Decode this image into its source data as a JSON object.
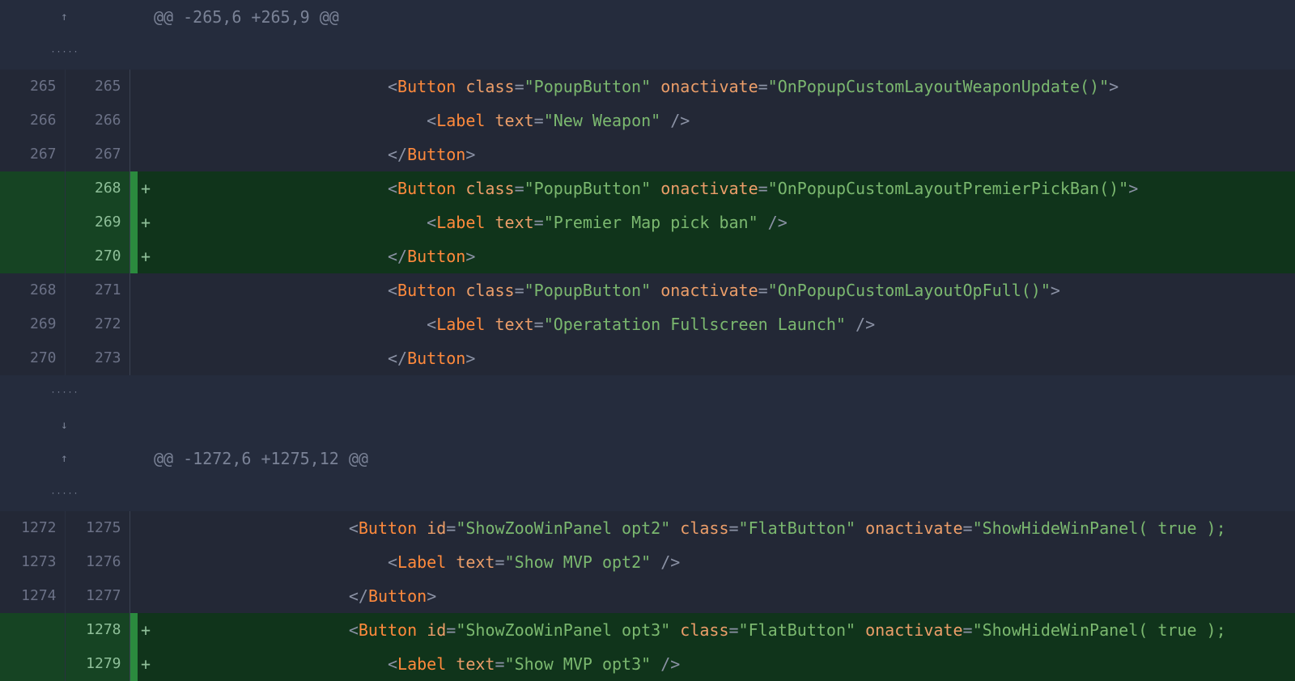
{
  "hunks": [
    {
      "header": "@@ -265,6 +265,9 @@"
    },
    {
      "header": "@@ -1272,6 +1275,12 @@"
    }
  ],
  "lines": [
    {
      "old": "265",
      "new": "265",
      "type": "ctx",
      "indent": 24,
      "tokens": [
        "&lt;",
        "Button",
        " ",
        "class",
        "=",
        "\"PopupButton\"",
        " ",
        "onactivate",
        "=",
        "\"OnPopupCustomLayoutWeaponUpdate()\"",
        "&gt;"
      ],
      "cls": [
        "pun",
        "tag",
        "",
        "attr",
        "eq",
        "str",
        "",
        "attr",
        "eq",
        "str",
        "pun"
      ]
    },
    {
      "old": "266",
      "new": "266",
      "type": "ctx",
      "indent": 28,
      "tokens": [
        "&lt;",
        "Label",
        " ",
        "text",
        "=",
        "\"New Weapon\"",
        " ",
        "/&gt;"
      ],
      "cls": [
        "pun",
        "tag",
        "",
        "attr",
        "eq",
        "str",
        "",
        "pun"
      ]
    },
    {
      "old": "267",
      "new": "267",
      "type": "ctx",
      "indent": 24,
      "tokens": [
        "&lt;/",
        "Button",
        "&gt;"
      ],
      "cls": [
        "pun",
        "tag",
        "pun"
      ]
    },
    {
      "old": "",
      "new": "268",
      "type": "add",
      "indent": 24,
      "tokens": [
        "&lt;",
        "Button",
        " ",
        "class",
        "=",
        "\"PopupButton\"",
        " ",
        "onactivate",
        "=",
        "\"OnPopupCustomLayoutPremierPickBan()\"",
        "&gt;"
      ],
      "cls": [
        "pun",
        "tag",
        "",
        "attr",
        "eq",
        "str",
        "",
        "attr",
        "eq",
        "str",
        "pun"
      ]
    },
    {
      "old": "",
      "new": "269",
      "type": "add",
      "indent": 28,
      "tokens": [
        "&lt;",
        "Label",
        " ",
        "text",
        "=",
        "\"Premier Map pick ban\"",
        " ",
        "/&gt;"
      ],
      "cls": [
        "pun",
        "tag",
        "",
        "attr",
        "eq",
        "str",
        "",
        "pun"
      ]
    },
    {
      "old": "",
      "new": "270",
      "type": "add",
      "indent": 24,
      "tokens": [
        "&lt;/",
        "Button",
        "&gt;"
      ],
      "cls": [
        "pun",
        "tag",
        "pun"
      ]
    },
    {
      "old": "268",
      "new": "271",
      "type": "ctx",
      "indent": 24,
      "tokens": [
        "&lt;",
        "Button",
        " ",
        "class",
        "=",
        "\"PopupButton\"",
        " ",
        "onactivate",
        "=",
        "\"OnPopupCustomLayoutOpFull()\"",
        "&gt;"
      ],
      "cls": [
        "pun",
        "tag",
        "",
        "attr",
        "eq",
        "str",
        "",
        "attr",
        "eq",
        "str",
        "pun"
      ]
    },
    {
      "old": "269",
      "new": "272",
      "type": "ctx",
      "indent": 28,
      "tokens": [
        "&lt;",
        "Label",
        " ",
        "text",
        "=",
        "\"Operatation Fullscreen Launch\"",
        " ",
        "/&gt;"
      ],
      "cls": [
        "pun",
        "tag",
        "",
        "attr",
        "eq",
        "str",
        "",
        "pun"
      ]
    },
    {
      "old": "270",
      "new": "273",
      "type": "ctx",
      "indent": 24,
      "tokens": [
        "&lt;/",
        "Button",
        "&gt;"
      ],
      "cls": [
        "pun",
        "tag",
        "pun"
      ]
    },
    {
      "old": "1272",
      "new": "1275",
      "type": "ctx",
      "indent": 20,
      "tokens": [
        "&lt;",
        "Button",
        " ",
        "id",
        "=",
        "\"ShowZooWinPanel opt2\"",
        " ",
        "class",
        "=",
        "\"FlatButton\"",
        " ",
        "onactivate",
        "=",
        "\"ShowHideWinPanel( true );"
      ],
      "cls": [
        "pun",
        "tag",
        "",
        "attr",
        "eq",
        "str",
        "",
        "attr",
        "eq",
        "str",
        "",
        "attr",
        "eq",
        "str"
      ]
    },
    {
      "old": "1273",
      "new": "1276",
      "type": "ctx",
      "indent": 24,
      "tokens": [
        "&lt;",
        "Label",
        " ",
        "text",
        "=",
        "\"Show MVP opt2\"",
        " ",
        "/&gt;"
      ],
      "cls": [
        "pun",
        "tag",
        "",
        "attr",
        "eq",
        "str",
        "",
        "pun"
      ]
    },
    {
      "old": "1274",
      "new": "1277",
      "type": "ctx",
      "indent": 20,
      "tokens": [
        "&lt;/",
        "Button",
        "&gt;"
      ],
      "cls": [
        "pun",
        "tag",
        "pun"
      ]
    },
    {
      "old": "",
      "new": "1278",
      "type": "add",
      "indent": 20,
      "tokens": [
        "&lt;",
        "Button",
        " ",
        "id",
        "=",
        "\"ShowZooWinPanel opt3\"",
        " ",
        "class",
        "=",
        "\"FlatButton\"",
        " ",
        "onactivate",
        "=",
        "\"ShowHideWinPanel( true );"
      ],
      "cls": [
        "pun",
        "tag",
        "",
        "attr",
        "eq",
        "str",
        "",
        "attr",
        "eq",
        "str",
        "",
        "attr",
        "eq",
        "str"
      ]
    },
    {
      "old": "",
      "new": "1279",
      "type": "add",
      "indent": 24,
      "tokens": [
        "&lt;",
        "Label",
        " ",
        "text",
        "=",
        "\"Show MVP opt3\"",
        " ",
        "/&gt;"
      ],
      "cls": [
        "pun",
        "tag",
        "",
        "attr",
        "eq",
        "str",
        "",
        "pun"
      ]
    }
  ],
  "expand": {
    "up_glyph": "↑",
    "down_glyph": "↓",
    "dots": "·····"
  },
  "colors": {
    "bg": "#1f2430",
    "add_bg": "#10341b",
    "hunk_bg": "#252c3d",
    "tag": "#ff8a3c",
    "attr": "#ec9e69",
    "str": "#7bb86f"
  }
}
